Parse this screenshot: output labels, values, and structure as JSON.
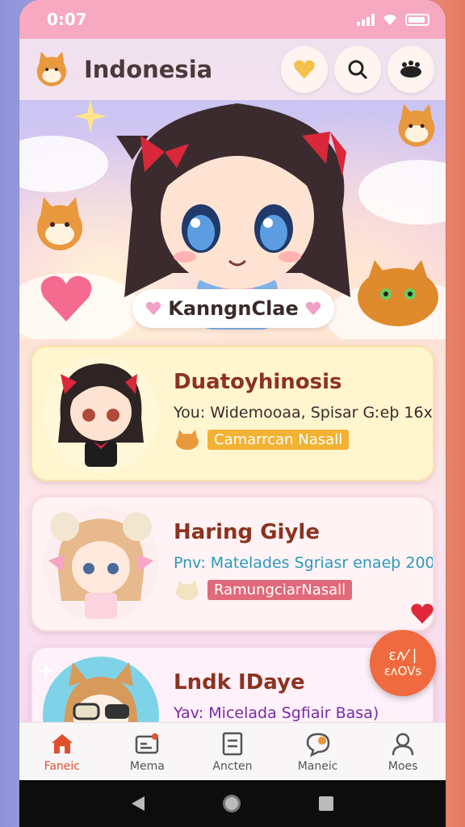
{
  "status": {
    "time": "0:07"
  },
  "appbar": {
    "title": "Indonesia",
    "icons": [
      "shiba-logo-icon",
      "heart-icon",
      "search-icon",
      "settings-icon"
    ]
  },
  "hero": {
    "name": "KanngnClae"
  },
  "cards": [
    {
      "title": "Duatoyhinosis",
      "subtitle": "You: Widemooaa, Spisar Gːeþ 16x:",
      "badge": "Camarrcan Nasall",
      "title_color": "#8b3320",
      "subtitle_color": "#3a2b2b",
      "badge_color": "#f2b233"
    },
    {
      "title": "Haring Giyle",
      "subtitle": "Pnv: Matelades Sgriasr enaeþ 200:",
      "badge": "RamungciarNasall",
      "title_color": "#8b3320",
      "subtitle_color": "#2a9bb8",
      "badge_color": "#e06a7a"
    },
    {
      "title": "Lndk IDaye",
      "subtitle": "Yav: Micelada Sgfiair Basa)",
      "title_color": "#8b3320",
      "subtitle_color": "#7a2aa8"
    }
  ],
  "fab": {
    "line1": "ɛʌ⁄ |",
    "line2": "ɛʌOVs"
  },
  "bottom_nav": [
    {
      "label": "Faneic",
      "icon": "home-icon",
      "active": true
    },
    {
      "label": "Mema",
      "icon": "media-icon",
      "active": false
    },
    {
      "label": "Ancten",
      "icon": "document-icon",
      "active": false
    },
    {
      "label": "Maneic",
      "icon": "chat-icon",
      "active": false
    },
    {
      "label": "Moes",
      "icon": "profile-icon",
      "active": false
    }
  ],
  "colors": {
    "accent": "#e0502f",
    "status_bar": "#f6a9c1",
    "fab": "#f06a3f"
  }
}
